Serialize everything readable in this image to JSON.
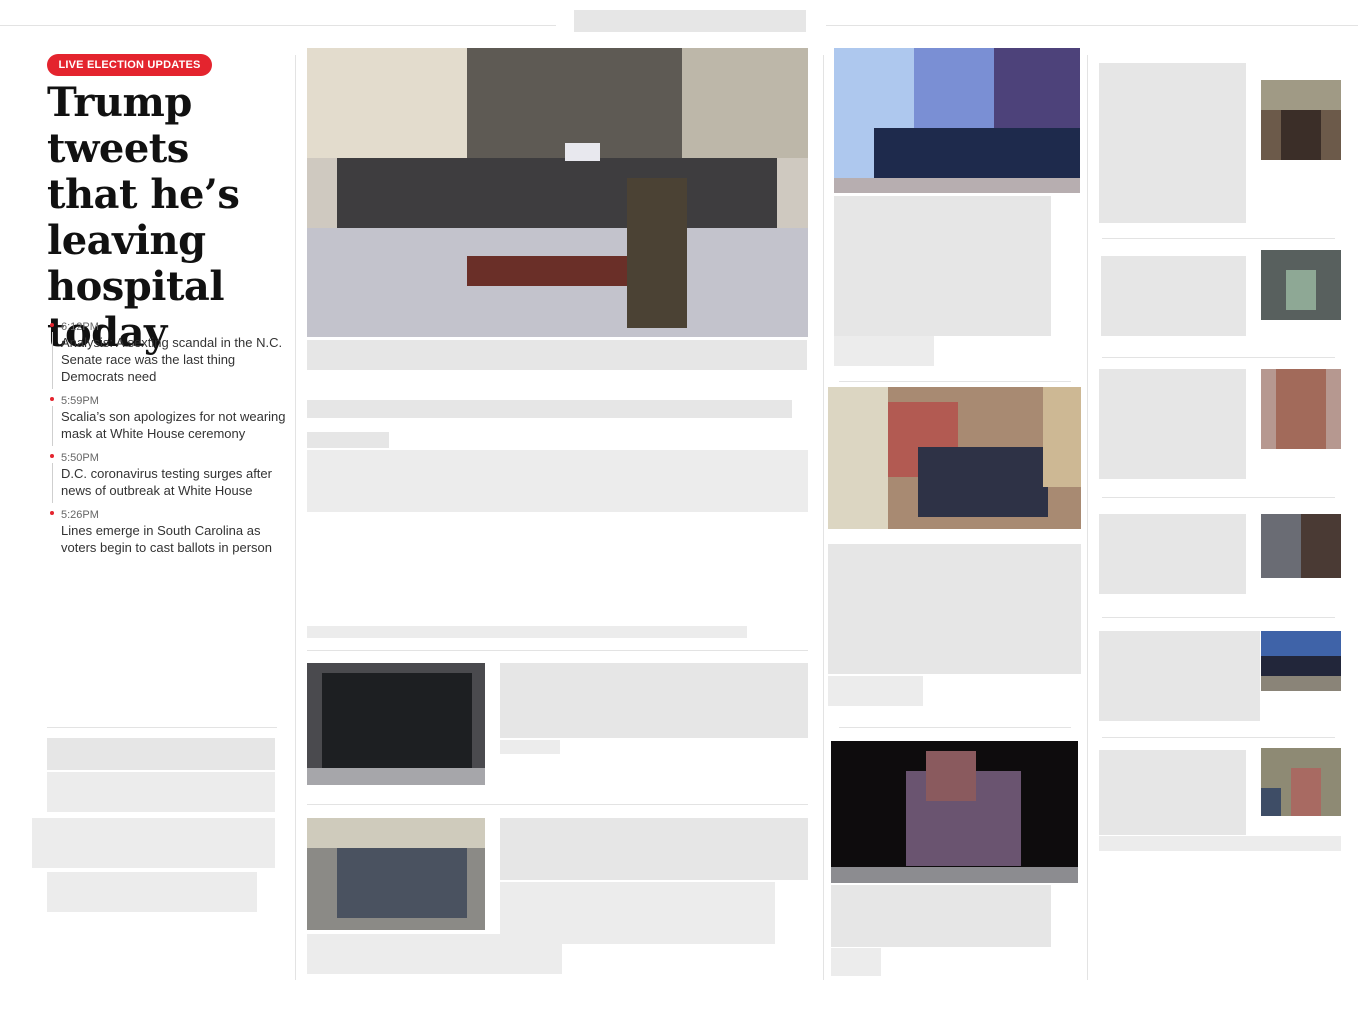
{
  "live_badge": "LIVE ELECTION UPDATES",
  "lead": {
    "headline": "Trump tweets that he’s leaving hospital today"
  },
  "updates": [
    {
      "time": "6:12PM",
      "text": "Analysis: A sexting scandal in the N.C. Senate race was the last thing Democrats need"
    },
    {
      "time": "5:59PM",
      "text": "Scalia’s son apologizes for not wearing mask at White House ceremony"
    },
    {
      "time": "5:50PM",
      "text": "D.C. coronavirus testing surges after news of outbreak at White House"
    },
    {
      "time": "5:26PM",
      "text": "Lines emerge in South Carolina as voters begin to cast ballots in person"
    }
  ],
  "colors": {
    "accent": "#e4242e"
  }
}
